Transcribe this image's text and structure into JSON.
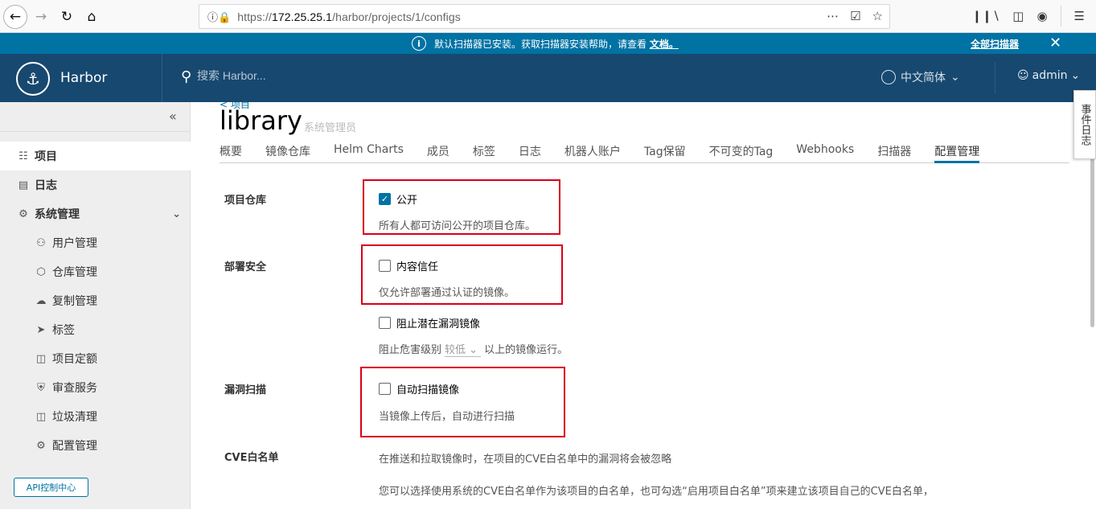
{
  "browser": {
    "url_prefix": "https://",
    "url_host": "172.25.25.1",
    "url_path": "/harbor/projects/1/configs"
  },
  "banner": {
    "message": "默认扫描器已安装。获取扫描器安装帮助，请查看",
    "doc_link": "文档。",
    "all_scanners": "全部扫描器"
  },
  "header": {
    "brand": "Harbor",
    "search_placeholder": "搜索 Harbor...",
    "language": "中文简体",
    "user": "admin"
  },
  "sidebar": {
    "items": [
      {
        "label": "项目",
        "icon": "projects-icon"
      },
      {
        "label": "日志",
        "icon": "logs-icon"
      },
      {
        "label": "系统管理",
        "icon": "admin-icon"
      },
      {
        "label": "用户管理",
        "icon": "users-icon"
      },
      {
        "label": "仓库管理",
        "icon": "registry-icon"
      },
      {
        "label": "复制管理",
        "icon": "replication-icon"
      },
      {
        "label": "标签",
        "icon": "label-icon"
      },
      {
        "label": "项目定额",
        "icon": "quota-icon"
      },
      {
        "label": "审查服务",
        "icon": "shield-icon"
      },
      {
        "label": "垃圾清理",
        "icon": "trash-icon"
      },
      {
        "label": "配置管理",
        "icon": "gear-icon"
      }
    ],
    "api_button": "API控制中心"
  },
  "main": {
    "back_link": "< 项目",
    "title": "library",
    "role": "系统管理员",
    "tabs": [
      "概要",
      "镜像仓库",
      "Helm Charts",
      "成员",
      "标签",
      "日志",
      "机器人账户",
      "Tag保留",
      "不可变的Tag",
      "Webhooks",
      "扫描器",
      "配置管理"
    ],
    "active_tab": "配置管理",
    "sections": {
      "repo": {
        "label": "项目仓库",
        "checkbox": "公开",
        "checked": true,
        "desc": "所有人都可访问公开的项目仓库。"
      },
      "deploy": {
        "label": "部署安全",
        "checkbox": "内容信任",
        "checked": false,
        "desc": "仅允许部署通过认证的镜像。",
        "vuln_checkbox": "阻止潜在漏洞镜像",
        "vuln_checked": false,
        "vuln_desc_before": "阻止危害级别",
        "vuln_level": "较低",
        "vuln_desc_after": "以上的镜像运行。"
      },
      "scan": {
        "label": "漏洞扫描",
        "checkbox": "自动扫描镜像",
        "checked": false,
        "desc": "当镜像上传后，自动进行扫描"
      },
      "cve": {
        "label": "CVE白名单",
        "desc1": "在推送和拉取镜像时，在项目的CVE白名单中的漏洞将会被忽略",
        "desc2": "您可以选择使用系统的CVE白名单作为该项目的白名单，也可勾选“启用项目白名单”项来建立该项目自己的CVE白名单，"
      }
    }
  },
  "event_tab": "事件日志",
  "colors": {
    "banner": "#0072a3",
    "header": "#17486f",
    "highlight": "#d9001b"
  }
}
